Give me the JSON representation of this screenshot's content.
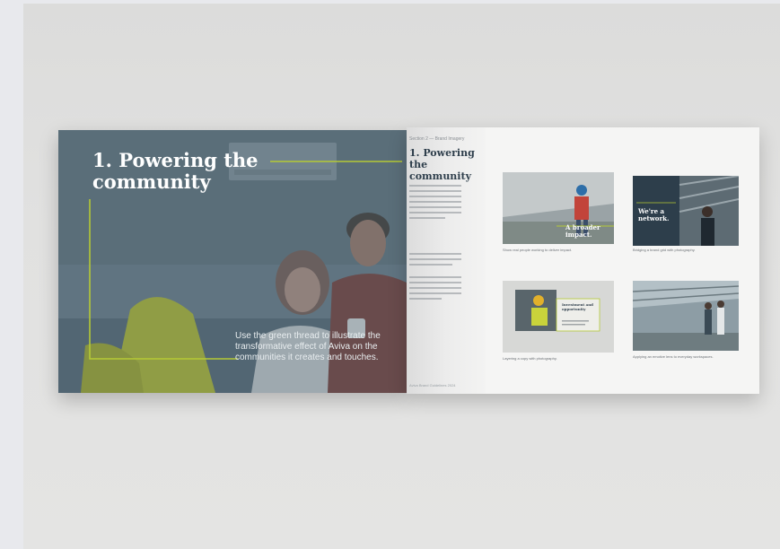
{
  "left_page": {
    "title": "1. Powering the community",
    "caption": "Use the green thread to illustrate the transformative effect of Aviva on the communities it creates and touches.",
    "accent_color": "#b5c935",
    "overlay_color": "#4f6572"
  },
  "right_page": {
    "kicker": "Section 2 — Brand Imagery",
    "title": "1. Powering the community",
    "footer": "Aviva Brand Guidelines 2024",
    "tiles": [
      {
        "overlay_text": "A broader impact.",
        "caption": "Show real people working to deliver impact."
      },
      {
        "overlay_text": "We're a network.",
        "caption": "Bridging a brand grid with photography."
      },
      {
        "overlay_text": "Investment and opportunity",
        "caption": "Layering a copy with photography."
      },
      {
        "overlay_text": "",
        "caption": "Applying an emotive lens to everyday workspaces."
      }
    ]
  }
}
